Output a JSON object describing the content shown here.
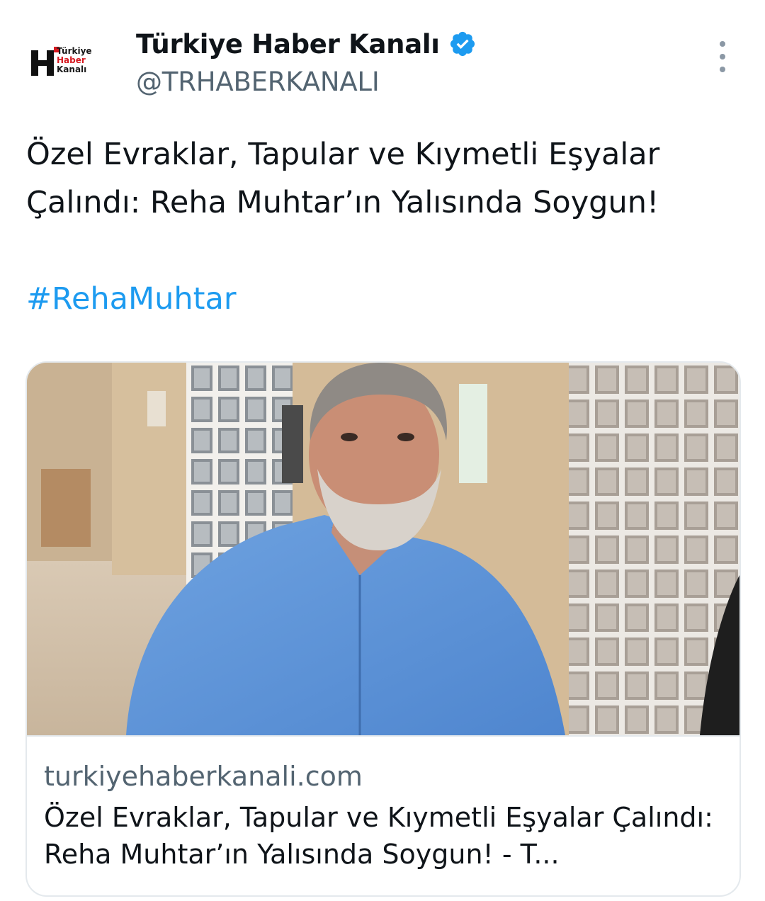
{
  "author": {
    "display_name": "Türkiye Haber Kanalı",
    "handle": "@TRHABERKANALI",
    "verified_icon": "verified-badge-icon",
    "avatar_logo_lines": [
      "Türkiye",
      "Haber",
      "Kanalı"
    ]
  },
  "tweet": {
    "text": "Özel Evraklar, Tapular ve Kıymetli Eşyalar Çalındı: Reha Muhtar’ın Yalısında Soygun!",
    "hashtag": "#RehaMuhtar"
  },
  "card": {
    "domain": "turkiyehaberkanali.com",
    "title": "Özel Evraklar, Tapular ve Kıymetli Eşyalar Çalındı: Reha Muhtar’ın Yalısında Soygun! - T..."
  },
  "colors": {
    "link": "#1d9bf0",
    "verified": "#1d9bf0",
    "brand_red": "#d71920",
    "secondary_text": "#536471"
  }
}
